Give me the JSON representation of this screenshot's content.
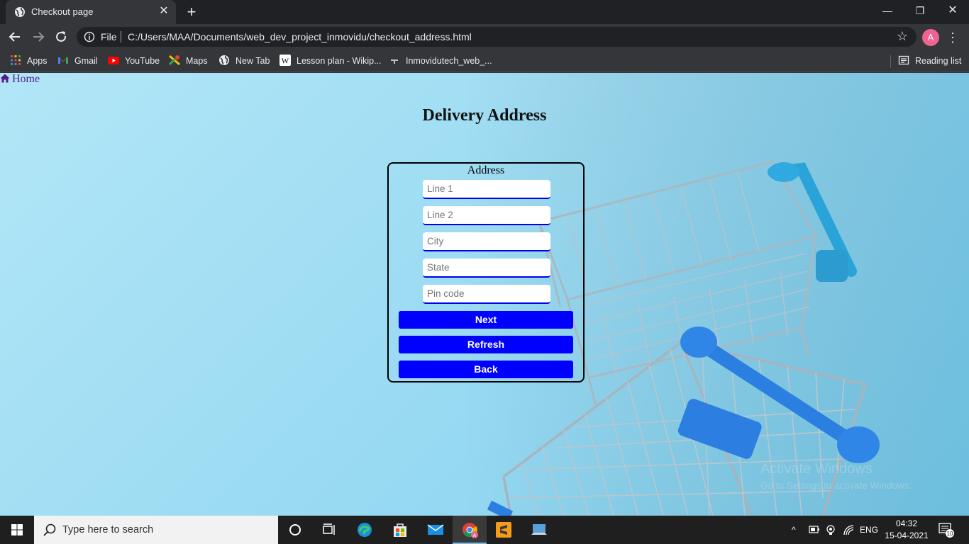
{
  "browser": {
    "tab_title": "Checkout page",
    "url_scheme": "File",
    "url": "C:/Users/MAA/Documents/web_dev_project_inmovidu/checkout_address.html",
    "profile_initial": "A",
    "bookmarks": [
      "Apps",
      "Gmail",
      "YouTube",
      "Maps",
      "New Tab",
      "Lesson plan - Wikip...",
      "Inmovidutech_web_..."
    ],
    "reading_list": "Reading list"
  },
  "page": {
    "home_link": "Home",
    "title": "Delivery Address",
    "legend": "Address",
    "fields": {
      "line1": "Line 1",
      "line2": "Line 2",
      "city": "City",
      "state": "State",
      "pincode": "Pin code"
    },
    "buttons": {
      "next": "Next",
      "refresh": "Refresh",
      "back": "Back"
    },
    "watermark": {
      "title": "Activate Windows",
      "subtitle": "Go to Settings to activate Windows."
    }
  },
  "taskbar": {
    "search_placeholder": "Type here to search",
    "language": "ENG",
    "time": "04:32",
    "date": "15-04-2021",
    "notification_count": "10"
  },
  "colors": {
    "button_blue": "#0000ff",
    "page_bg": "#9ddcf3",
    "chrome_dark": "#202124"
  }
}
